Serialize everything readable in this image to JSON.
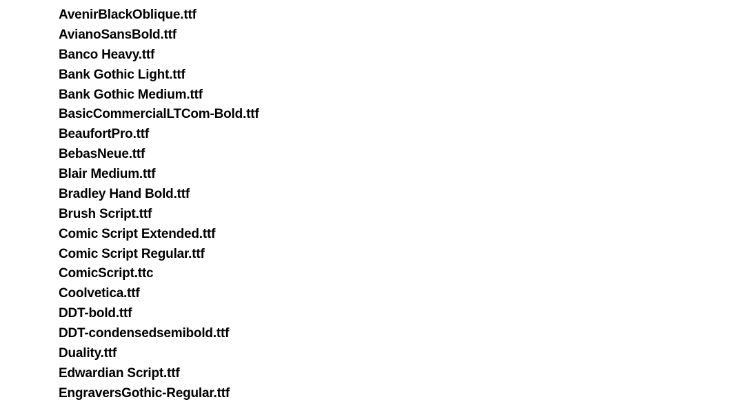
{
  "fontFiles": [
    "AvenirBlackOblique.ttf",
    "AvianoSansBold.ttf",
    "Banco Heavy.ttf",
    "Bank Gothic Light.ttf",
    "Bank Gothic Medium.ttf",
    "BasicCommercialLTCom-Bold.ttf",
    "BeaufortPro.ttf",
    "BebasNeue.ttf",
    "Blair Medium.ttf",
    "Bradley Hand Bold.ttf",
    "Brush Script.ttf",
    "Comic Script Extended.ttf",
    "Comic Script Regular.ttf",
    "ComicScript.ttc",
    "Coolvetica.ttf",
    "DDT-bold.ttf",
    "DDT-condensedsemibold.ttf",
    "Duality.ttf",
    "Edwardian Script.ttf",
    "EngraversGothic-Regular.ttf"
  ]
}
